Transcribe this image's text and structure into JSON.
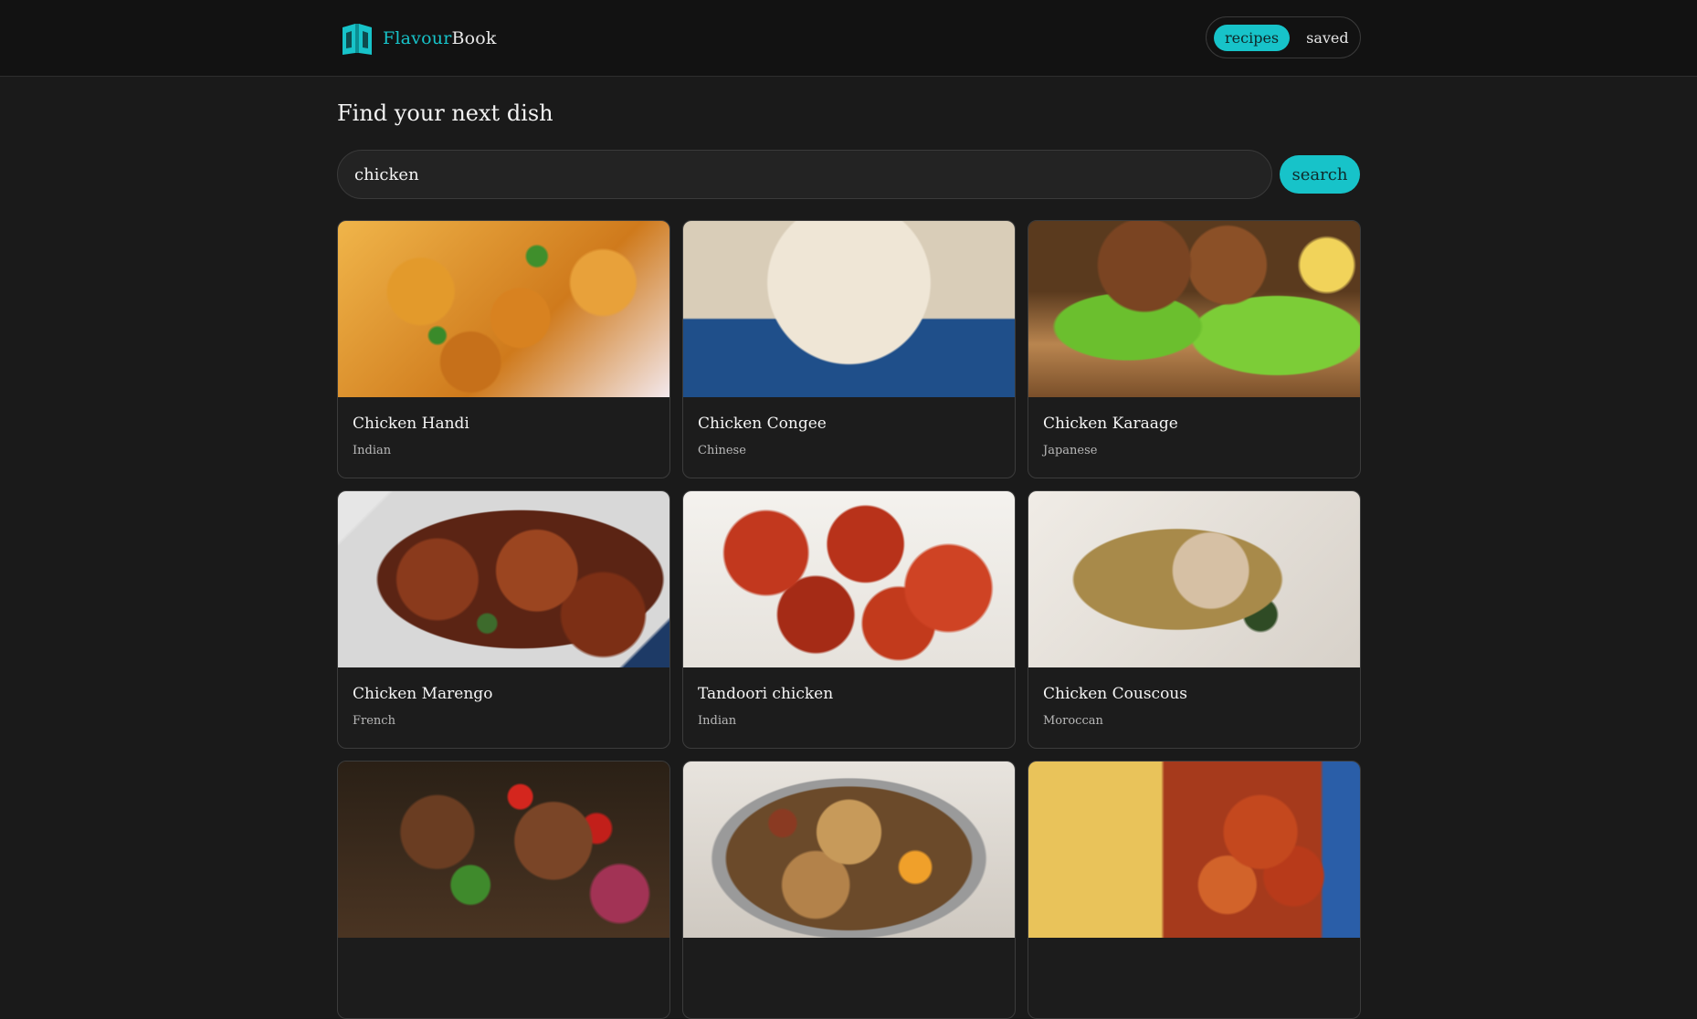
{
  "brand": {
    "part1": "Flavour",
    "part2": "Book"
  },
  "nav": {
    "recipes_label": "recipes",
    "saved_label": "saved",
    "active": "recipes"
  },
  "page": {
    "heading": "Find your next dish"
  },
  "search": {
    "value": "chicken",
    "button_label": "search"
  },
  "colors": {
    "accent": "#17c3c9",
    "background": "#1a1a1a",
    "header": "#121212"
  },
  "results": [
    {
      "title": "Chicken Handi",
      "cuisine": "Indian"
    },
    {
      "title": "Chicken Congee",
      "cuisine": "Chinese"
    },
    {
      "title": "Chicken Karaage",
      "cuisine": "Japanese"
    },
    {
      "title": "Chicken Marengo",
      "cuisine": "French"
    },
    {
      "title": "Tandoori chicken",
      "cuisine": "Indian"
    },
    {
      "title": "Chicken Couscous",
      "cuisine": "Moroccan"
    },
    {
      "title": "",
      "cuisine": ""
    },
    {
      "title": "",
      "cuisine": ""
    },
    {
      "title": "",
      "cuisine": ""
    }
  ]
}
